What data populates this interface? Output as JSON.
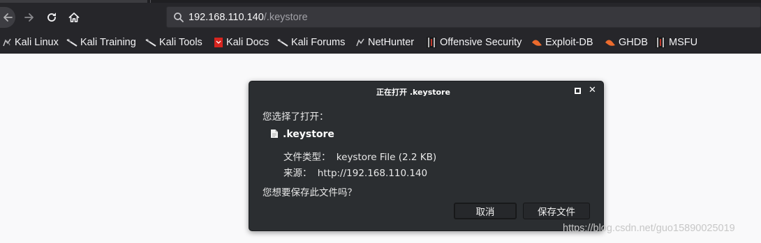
{
  "browser": {
    "url_host": "192.168.110.140",
    "url_path": "/.keystore",
    "search_icon": "search-icon",
    "nav_icons": [
      "back-arrow-icon",
      "forward-arrow-icon",
      "reload-icon",
      "home-icon"
    ]
  },
  "bookmarks": [
    {
      "label": "Kali Linux",
      "icon": "kali-dragon-icon"
    },
    {
      "label": "Kali Training",
      "icon": "kali-dragon-icon"
    },
    {
      "label": "Kali Tools",
      "icon": "kali-dragon-icon"
    },
    {
      "label": "Kali Docs",
      "icon": "kali-docs-icon"
    },
    {
      "label": "Kali Forums",
      "icon": "kali-dragon-icon"
    },
    {
      "label": "NetHunter",
      "icon": "nethunter-icon"
    },
    {
      "label": "Offensive Security",
      "icon": "offsec-icon"
    },
    {
      "label": "Exploit-DB",
      "icon": "exploit-db-icon"
    },
    {
      "label": "GHDB",
      "icon": "ghdb-icon"
    },
    {
      "label": "MSFU",
      "icon": "offsec-icon"
    }
  ],
  "dialog": {
    "title": "正在打开 .keystore",
    "chosen_label": "您选择了打开：",
    "filename": ".keystore",
    "type_label": "文件类型：",
    "type_value": "keystore File (2.2 KB)",
    "source_label": "来源：",
    "source_value": "http://192.168.110.140",
    "question": "您想要保存此文件吗？",
    "cancel_label": "取消",
    "save_label": "保存文件"
  },
  "watermark": "https://blog.csdn.net/guo15890025019",
  "colors": {
    "toolbar_bg": "#26262a",
    "urlbar_bg": "#38383d",
    "dialog_bg": "#2b2e31",
    "page_bg": "#f9f9fa",
    "exploit_orange": "#ec6b2d",
    "docs_red": "#d7251f"
  }
}
